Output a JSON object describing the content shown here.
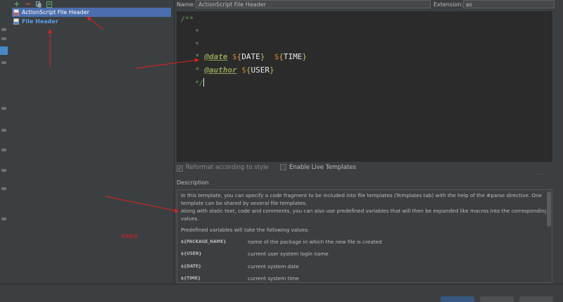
{
  "toolbar": {
    "add_icon": "plus-icon",
    "remove_icon": "minus-icon",
    "copy_icon": "copy-icon",
    "reset_icon": "reset-icon"
  },
  "templates": [
    {
      "label": "ActionScript File Header",
      "selected": true
    },
    {
      "label": "File Header",
      "selected": false
    }
  ],
  "header": {
    "name_label": "Name:",
    "name_value": "ActionScript File Header",
    "ext_label": "Extension:",
    "ext_value": "as"
  },
  "editor": {
    "line1": "/**",
    "line2": "*",
    "line3": "*",
    "line4_star": "*",
    "line4_tag": "@date",
    "line4_d1": "$",
    "line4_b1": "{",
    "line4_v1": "DATE",
    "line4_b2": "}",
    "line4_d2": "$",
    "line4_b3": "{",
    "line4_v2": "TIME",
    "line4_b4": "}",
    "line5_star": "*",
    "line5_tag": "@author",
    "line5_d1": "$",
    "line5_b1": "{",
    "line5_v1": "USER",
    "line5_b2": "}",
    "line6": "*/"
  },
  "options": {
    "reformat_label": "Reformat according to style",
    "reformat_checked": true,
    "live_label": "Enable Live Templates",
    "live_checked": false
  },
  "description": {
    "label": "Description",
    "para1": "In this template, you can specify a code fragment to be included into file templates (Templates tab) with the help of the #parse directive. One template can be shared by several file templates.",
    "para2": "Along with static text, code and comments, you can also use predefined variables that will then be expanded like macros into the corresponding values.",
    "para3": "Predefined variables will take the following values:",
    "variables": [
      {
        "name": "${PACKAGE_NAME}",
        "desc": "name of the package in which the new file is created"
      },
      {
        "name": "${USER}",
        "desc": "current user system login name"
      },
      {
        "name": "${DATE}",
        "desc": "current system date"
      },
      {
        "name": "${TIME}",
        "desc": "current system time"
      }
    ]
  },
  "annotation": "说明信息",
  "colors": {
    "accent": "#4b6eaf",
    "editor_bg": "#2b2b2b",
    "arrow": "#e02020"
  }
}
